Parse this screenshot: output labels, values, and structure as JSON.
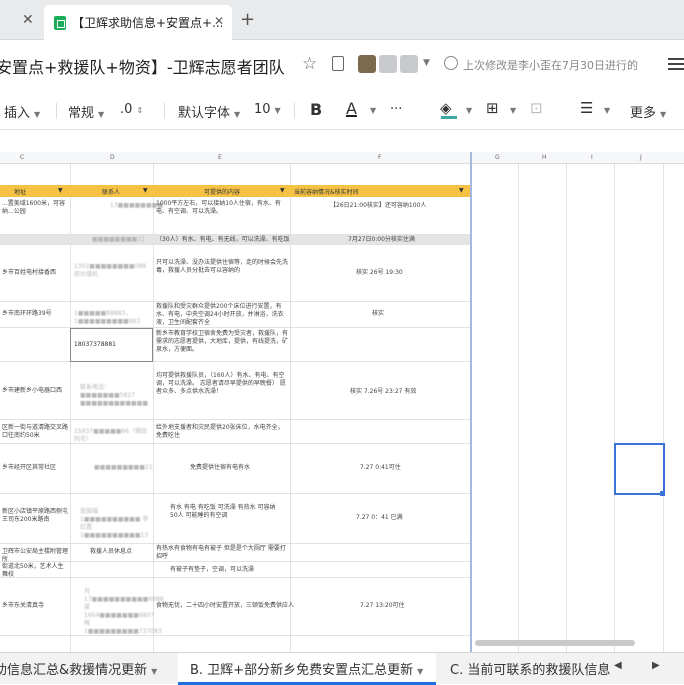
{
  "browser": {
    "tab_title": "【卫辉求助信息+安置点+...",
    "new_tab": "+",
    "close": "✕"
  },
  "doc": {
    "title": "安置点+救援队+物资】-卫辉志愿者团队",
    "saved_text": "上次修改是李小歪在7月30日进行的"
  },
  "toolbar": {
    "insert": "插入",
    "format": "常规",
    "decimal": ".0",
    "font": "默认字体",
    "size": "10",
    "bold": "B",
    "color": "A",
    "more_dots": "···",
    "more": "更多"
  },
  "columns": [
    "C",
    "D",
    "E",
    "F",
    "G",
    "H",
    "I",
    "J"
  ],
  "header_row": {
    "address": "地址",
    "contact": "联系人",
    "content": "可提供的内容",
    "status": "当前容纳情况&核实时间"
  },
  "rows": [
    {
      "address": "...置美域1600米，可容纳...公园",
      "contact": "13■■■■■■■■",
      "content": "1000平方左右，可以接纳10人住宿，有水、有电、有空调、可以洗澡。",
      "status": "【26日21:00核实】还可容纳100人"
    },
    {
      "address": "",
      "contact": "■■■■■■■■11",
      "content": "（30人）有水、有电、有无线，可以洗澡、有吃饭",
      "status": "7月27日0:00分核实住满"
    },
    {
      "address": "乡市百姓电村接香西",
      "contact": "1302■■■■■■■■088 前台值机",
      "content": "只可以洗澡、没办法提供住宿等，走的时候会先洗毒，救援人员分批去可以容纳的",
      "status": "核实 26号 19:30"
    },
    {
      "address": "乡市南环环路39号",
      "contact": "1■■■■■88883，1■■■■■■■■■883",
      "content": "救援队和受灾群众提供200个床位进行安置，有水、有电，中央空调24小时开放，并淋浴，洗衣液，卫生间配套齐全",
      "status": "核实"
    },
    {
      "address": "",
      "contact": "18037378881",
      "content": "新乡市教育学校卫宿舍免费为受灾者，救援队，有需求的志愿者提供，大地库，提供，有线提洗，矿泉水，方便面。",
      "status": ""
    },
    {
      "address": "乡市建新乡小电器口西",
      "contact": "联系电话：■■■■■■■5827 ■■■■■■■■■■■■",
      "content": "均可提供救援队员，（160人）有水、有电、有空调，可以洗澡。 志愿者请尽早提供的早晚餐） 愿者众多、多点供水洗澡！",
      "status": "核实 7.26号 23:27 有效"
    },
    {
      "address": "区新一街与道清路交叉路口往南约50米",
      "contact": "15937■■■■■66（微信同号）",
      "content": "给外地支援者和灾民提供20张床位，水电齐全，免费吃住",
      "status": ""
    },
    {
      "address": "乡市经开区其常社区",
      "contact": "■■■■■■■■■21",
      "content": "免费提供住宿有电有水",
      "status": "7.27 0:41可住"
    },
    {
      "address": "新区小店镇平原路西侧屯王司东200米路南",
      "contact": "张国福1■■■■■■■■■■ 李红霞1■■■■■■■■■■13",
      "content": "有水 有电 有吃饭 可洗澡 有热水 可容纳50人 可能睡的有空调",
      "status": "7.27 0：41 已满"
    },
    {
      "address": "卫辉市公安局主楼附管理所",
      "contact": "救援人员休息点",
      "content": "有热水有食物有电有被子 但是是个大厕厅 需要打招呼",
      "status": ""
    },
    {
      "address": "街道北50米，艺术人生舞校",
      "contact": "",
      "content": "有被子有垫子，空调，可以洗澡",
      "status": ""
    },
    {
      "address": "乡市东关清真寺",
      "contact": "刘17■■■■■■■■■■6888 梁 1664■■■■■■■6807 梅 1■■■■■■■■■737083",
      "content": "食物无忧，二十四小时安置开放，三顿饭免费供应人",
      "status": "7.27 13:20可住"
    }
  ],
  "sheet_tabs": {
    "tab1": "助信息汇总&救援情况更新",
    "tab2": "B. 卫辉+部分新乡免费安置点汇总更新",
    "tab3": "C. 当前可联系的救援队信息"
  },
  "colors": {
    "accent": "#1e6fe0",
    "header_fill": "#f6c244",
    "sheet_icon": "#1aae5b"
  }
}
